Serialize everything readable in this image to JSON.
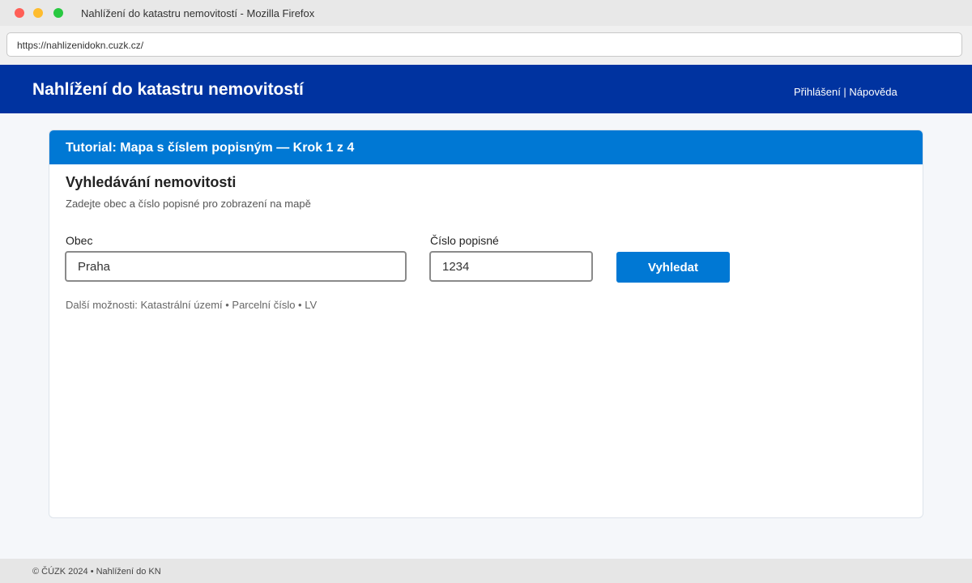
{
  "window": {
    "title": "Nahlížení do katastru nemovitostí - Mozilla Firefox"
  },
  "browser": {
    "url": "https://nahlizenidokn.cuzk.cz/"
  },
  "header": {
    "title": "Nahlížení do katastru nemovitostí",
    "links": [
      {
        "label": "Přihlášení"
      },
      {
        "label": "Nápověda"
      }
    ],
    "separator": " | "
  },
  "tutorial": {
    "banner": "Tutorial: Mapa s číslem popisným — Krok 1 z 4"
  },
  "search": {
    "title": "Vyhledávání nemovitosti",
    "subtitle": "Zadejte obec a číslo popisné pro zobrazení na mapě",
    "obec_label": "Obec",
    "obec_value": "Praha",
    "cp_label": "Číslo popisné",
    "cp_value": "1234",
    "button_label": "Vyhledat",
    "more_options": "Další možnosti: Katastrální území • Parcelní číslo • LV"
  },
  "footer": {
    "text": "© ČÚZK 2024 • Nahlížení do KN"
  },
  "colors": {
    "header_bg": "#0033a0",
    "banner_bg": "#0078d4",
    "button_bg": "#0078d4",
    "page_bg": "#f5f7fa"
  }
}
